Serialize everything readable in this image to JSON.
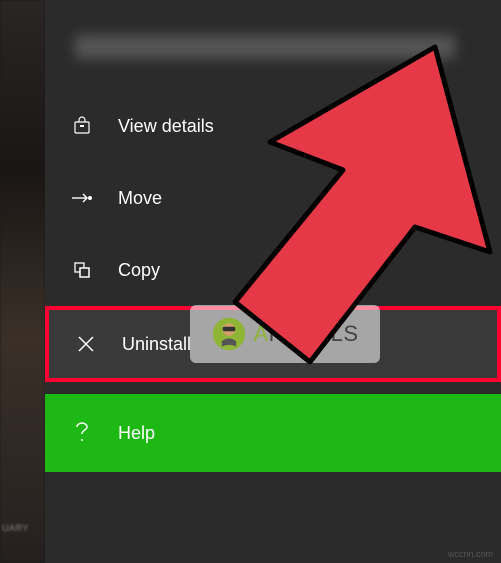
{
  "background": {
    "partial_text": "UARY"
  },
  "menu": {
    "items": [
      {
        "label": "View details",
        "icon": "bag-icon"
      },
      {
        "label": "Move",
        "icon": "move-icon"
      },
      {
        "label": "Copy",
        "icon": "copy-icon"
      },
      {
        "label": "Uninstall",
        "icon": "close-icon",
        "highlighted": true
      },
      {
        "label": "Help",
        "icon": "question-icon",
        "style": "help"
      }
    ]
  },
  "watermark": {
    "text": "PPUALS",
    "prefix": "A"
  },
  "footer_watermark": "wccnn.com",
  "annotation": {
    "arrow_color": "#e53947",
    "highlight_color": "#ff0033",
    "help_bg": "#1eb814"
  }
}
